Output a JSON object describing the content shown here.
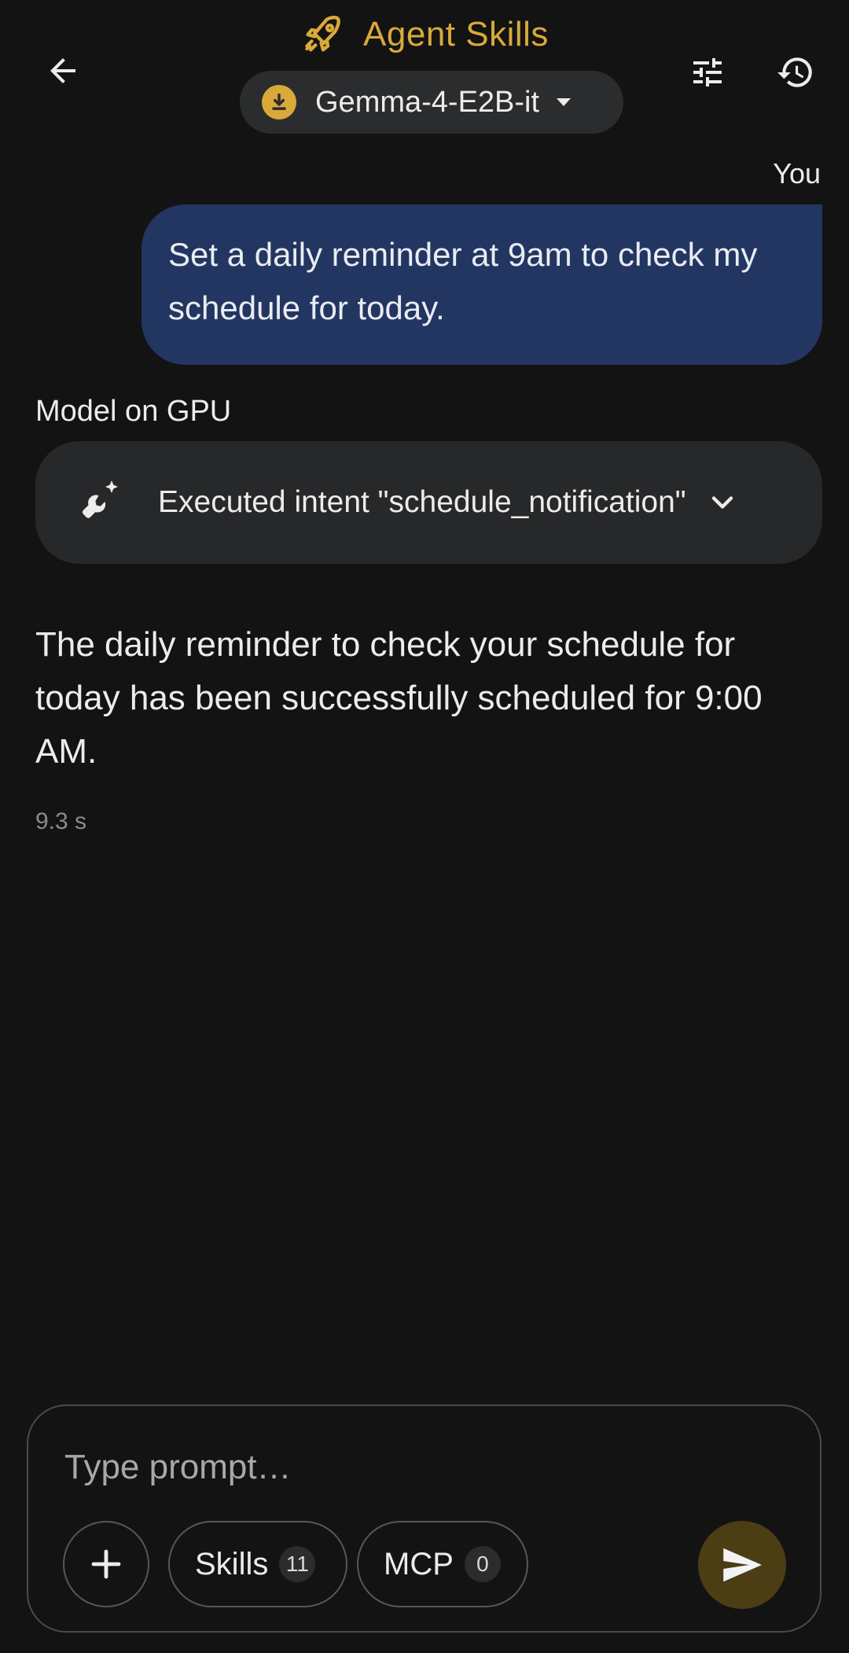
{
  "header": {
    "title": "Agent Skills",
    "model_name": "Gemma-4-E2B-it",
    "icons": {
      "back": "arrow-left-icon",
      "title": "rocket-icon",
      "download": "download-icon",
      "dropdown": "caret-down-icon",
      "settings": "tune-icon",
      "history": "history-icon"
    }
  },
  "chat": {
    "user_label": "You",
    "user_message": "Set a daily reminder at 9am to check my schedule for today.",
    "model_label": "Model on GPU",
    "intent_text": "Executed intent \"schedule_notification\"",
    "response": "The daily reminder to check your schedule for today has been successfully scheduled for 9:00 AM.",
    "latency": "9.3 s"
  },
  "composer": {
    "placeholder": "Type prompt…",
    "skills_label": "Skills",
    "skills_count": "11",
    "mcp_label": "MCP",
    "mcp_count": "0"
  },
  "colors": {
    "accent": "#d9a93a",
    "background": "#131313",
    "user_bubble": "#233661",
    "card": "#27282a",
    "send_button": "#4b3d14"
  }
}
